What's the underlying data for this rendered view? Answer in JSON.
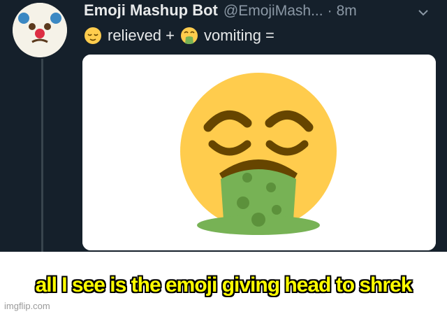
{
  "tweet": {
    "display_name": "Emoji Mashup Bot",
    "handle": "@EmojiMash...",
    "separator": "·",
    "time": "8m",
    "text_part1": "relieved +",
    "text_part2": "vomiting =",
    "emoji_1": "relieved-face",
    "emoji_2": "face-vomiting"
  },
  "caption": "all I see is the emoji giving head to shrek",
  "watermark": "imgflip.com",
  "colors": {
    "background": "#15202b",
    "caption_text": "#ffff00",
    "emoji_yellow": "#ffcc4d",
    "vomit_green": "#77b255"
  }
}
